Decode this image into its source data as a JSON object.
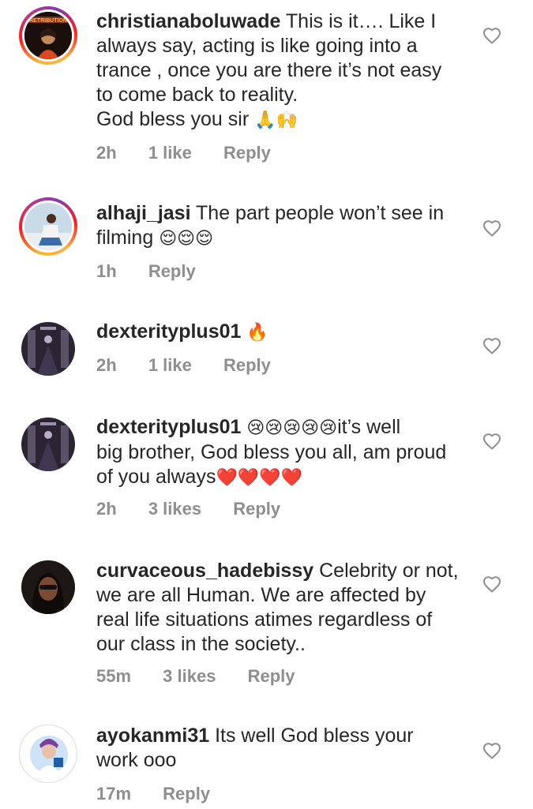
{
  "comments": [
    {
      "username": "christianaboluwade",
      "text_lines": [
        "This is it…. Like I",
        "always say, acting is like going into a",
        "trance , once you are there it’s not easy",
        "to come back to reality.",
        "God bless you sir"
      ],
      "emoji_suffix": "🙏🙌",
      "time": "2h",
      "likes": "1 like",
      "reply": "Reply",
      "avatar_label": "RETRIBUTION"
    },
    {
      "username": "alhaji_jasi",
      "text_lines": [
        "The part people won’t see in",
        "filming"
      ],
      "emoji_suffix": "😌😌😌",
      "time": "1h",
      "likes": "",
      "reply": "Reply"
    },
    {
      "username": "dexterityplus01",
      "text_lines": [
        ""
      ],
      "emoji_suffix": "🔥",
      "time": "2h",
      "likes": "1 like",
      "reply": "Reply"
    },
    {
      "username": "dexterityplus01",
      "emoji_prefix": "😢😢😢😢😢",
      "text_lines": [
        "it’s well",
        "big brother, God bless you all, am proud",
        "of you always"
      ],
      "emoji_suffix": "❤️❤️❤️❤️",
      "time": "2h",
      "likes": "3 likes",
      "reply": "Reply"
    },
    {
      "username": "curvaceous_hadebissy",
      "text_lines": [
        "Celebrity or not,",
        "we are all Human. We are affected by",
        "real life situations atimes regardless of",
        "our class in the society.."
      ],
      "time": "55m",
      "likes": "3 likes",
      "reply": "Reply"
    },
    {
      "username": "ayokanmi31",
      "text_lines": [
        "Its well God bless your",
        "work ooo"
      ],
      "time": "17m",
      "likes": "",
      "reply": "Reply"
    }
  ],
  "icons": {
    "like": "heart-outline-icon"
  },
  "colors": {
    "text": "#262626",
    "meta": "#8e8e8e",
    "ring_start": "#f7b733",
    "ring_end": "#c13584"
  }
}
